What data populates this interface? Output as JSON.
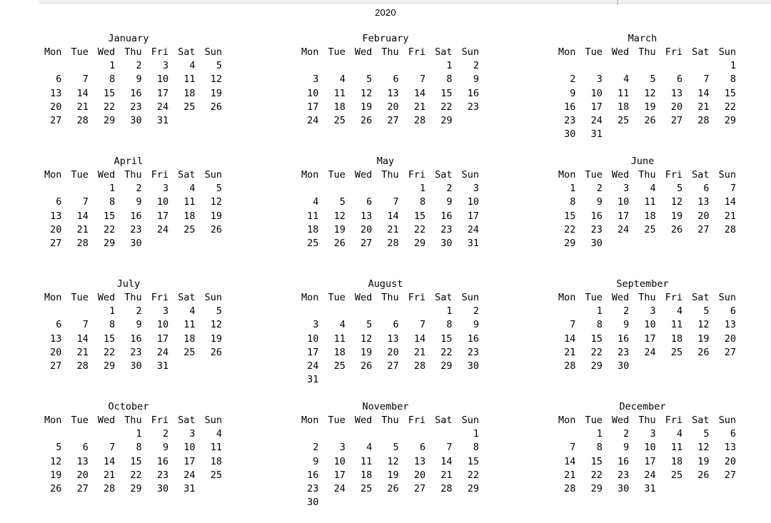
{
  "chrome": {
    "marker_color": "#e8b3bb",
    "bar_color": "#f1f1f1"
  },
  "title": "2020",
  "weekday_headers": [
    "Mon",
    "Tue",
    "Wed",
    "Thu",
    "Fri",
    "Sat",
    "Sun"
  ],
  "week_start": "Mon",
  "colors": {
    "text": "#000000",
    "background": "#ffffff"
  },
  "months": [
    {
      "name": "January",
      "weeks": [
        [
          "",
          "",
          "1",
          "2",
          "3",
          "4",
          "5"
        ],
        [
          "6",
          "7",
          "8",
          "9",
          "10",
          "11",
          "12"
        ],
        [
          "13",
          "14",
          "15",
          "16",
          "17",
          "18",
          "19"
        ],
        [
          "20",
          "21",
          "22",
          "23",
          "24",
          "25",
          "26"
        ],
        [
          "27",
          "28",
          "29",
          "30",
          "31",
          "",
          ""
        ]
      ]
    },
    {
      "name": "February",
      "weeks": [
        [
          "",
          "",
          "",
          "",
          "",
          "1",
          "2"
        ],
        [
          "3",
          "4",
          "5",
          "6",
          "7",
          "8",
          "9"
        ],
        [
          "10",
          "11",
          "12",
          "13",
          "14",
          "15",
          "16"
        ],
        [
          "17",
          "18",
          "19",
          "20",
          "21",
          "22",
          "23"
        ],
        [
          "24",
          "25",
          "26",
          "27",
          "28",
          "29",
          ""
        ]
      ]
    },
    {
      "name": "March",
      "weeks": [
        [
          "",
          "",
          "",
          "",
          "",
          "",
          "1"
        ],
        [
          "2",
          "3",
          "4",
          "5",
          "6",
          "7",
          "8"
        ],
        [
          "9",
          "10",
          "11",
          "12",
          "13",
          "14",
          "15"
        ],
        [
          "16",
          "17",
          "18",
          "19",
          "20",
          "21",
          "22"
        ],
        [
          "23",
          "24",
          "25",
          "26",
          "27",
          "28",
          "29"
        ],
        [
          "30",
          "31",
          "",
          "",
          "",
          "",
          ""
        ]
      ]
    },
    {
      "name": "April",
      "weeks": [
        [
          "",
          "",
          "1",
          "2",
          "3",
          "4",
          "5"
        ],
        [
          "6",
          "7",
          "8",
          "9",
          "10",
          "11",
          "12"
        ],
        [
          "13",
          "14",
          "15",
          "16",
          "17",
          "18",
          "19"
        ],
        [
          "20",
          "21",
          "22",
          "23",
          "24",
          "25",
          "26"
        ],
        [
          "27",
          "28",
          "29",
          "30",
          "",
          "",
          ""
        ]
      ]
    },
    {
      "name": "May",
      "weeks": [
        [
          "",
          "",
          "",
          "",
          "1",
          "2",
          "3"
        ],
        [
          "4",
          "5",
          "6",
          "7",
          "8",
          "9",
          "10"
        ],
        [
          "11",
          "12",
          "13",
          "14",
          "15",
          "16",
          "17"
        ],
        [
          "18",
          "19",
          "20",
          "21",
          "22",
          "23",
          "24"
        ],
        [
          "25",
          "26",
          "27",
          "28",
          "29",
          "30",
          "31"
        ]
      ]
    },
    {
      "name": "June",
      "weeks": [
        [
          "1",
          "2",
          "3",
          "4",
          "5",
          "6",
          "7"
        ],
        [
          "8",
          "9",
          "10",
          "11",
          "12",
          "13",
          "14"
        ],
        [
          "15",
          "16",
          "17",
          "18",
          "19",
          "20",
          "21"
        ],
        [
          "22",
          "23",
          "24",
          "25",
          "26",
          "27",
          "28"
        ],
        [
          "29",
          "30",
          "",
          "",
          "",
          "",
          ""
        ]
      ]
    },
    {
      "name": "July",
      "weeks": [
        [
          "",
          "",
          "1",
          "2",
          "3",
          "4",
          "5"
        ],
        [
          "6",
          "7",
          "8",
          "9",
          "10",
          "11",
          "12"
        ],
        [
          "13",
          "14",
          "15",
          "16",
          "17",
          "18",
          "19"
        ],
        [
          "20",
          "21",
          "22",
          "23",
          "24",
          "25",
          "26"
        ],
        [
          "27",
          "28",
          "29",
          "30",
          "31",
          "",
          ""
        ]
      ]
    },
    {
      "name": "August",
      "weeks": [
        [
          "",
          "",
          "",
          "",
          "",
          "1",
          "2"
        ],
        [
          "3",
          "4",
          "5",
          "6",
          "7",
          "8",
          "9"
        ],
        [
          "10",
          "11",
          "12",
          "13",
          "14",
          "15",
          "16"
        ],
        [
          "17",
          "18",
          "19",
          "20",
          "21",
          "22",
          "23"
        ],
        [
          "24",
          "25",
          "26",
          "27",
          "28",
          "29",
          "30"
        ],
        [
          "31",
          "",
          "",
          "",
          "",
          "",
          ""
        ]
      ]
    },
    {
      "name": "September",
      "weeks": [
        [
          "",
          "1",
          "2",
          "3",
          "4",
          "5",
          "6"
        ],
        [
          "7",
          "8",
          "9",
          "10",
          "11",
          "12",
          "13"
        ],
        [
          "14",
          "15",
          "16",
          "17",
          "18",
          "19",
          "20"
        ],
        [
          "21",
          "22",
          "23",
          "24",
          "25",
          "26",
          "27"
        ],
        [
          "28",
          "29",
          "30",
          "",
          "",
          "",
          ""
        ]
      ]
    },
    {
      "name": "October",
      "weeks": [
        [
          "",
          "",
          "",
          "1",
          "2",
          "3",
          "4"
        ],
        [
          "5",
          "6",
          "7",
          "8",
          "9",
          "10",
          "11"
        ],
        [
          "12",
          "13",
          "14",
          "15",
          "16",
          "17",
          "18"
        ],
        [
          "19",
          "20",
          "21",
          "22",
          "23",
          "24",
          "25"
        ],
        [
          "26",
          "27",
          "28",
          "29",
          "30",
          "31",
          ""
        ]
      ]
    },
    {
      "name": "November",
      "weeks": [
        [
          "",
          "",
          "",
          "",
          "",
          "",
          "1"
        ],
        [
          "2",
          "3",
          "4",
          "5",
          "6",
          "7",
          "8"
        ],
        [
          "9",
          "10",
          "11",
          "12",
          "13",
          "14",
          "15"
        ],
        [
          "16",
          "17",
          "18",
          "19",
          "20",
          "21",
          "22"
        ],
        [
          "23",
          "24",
          "25",
          "26",
          "27",
          "28",
          "29"
        ],
        [
          "30",
          "",
          "",
          "",
          "",
          "",
          ""
        ]
      ]
    },
    {
      "name": "December",
      "weeks": [
        [
          "",
          "1",
          "2",
          "3",
          "4",
          "5",
          "6"
        ],
        [
          "7",
          "8",
          "9",
          "10",
          "11",
          "12",
          "13"
        ],
        [
          "14",
          "15",
          "16",
          "17",
          "18",
          "19",
          "20"
        ],
        [
          "21",
          "22",
          "23",
          "24",
          "25",
          "26",
          "27"
        ],
        [
          "28",
          "29",
          "30",
          "31",
          "",
          "",
          ""
        ]
      ]
    }
  ]
}
